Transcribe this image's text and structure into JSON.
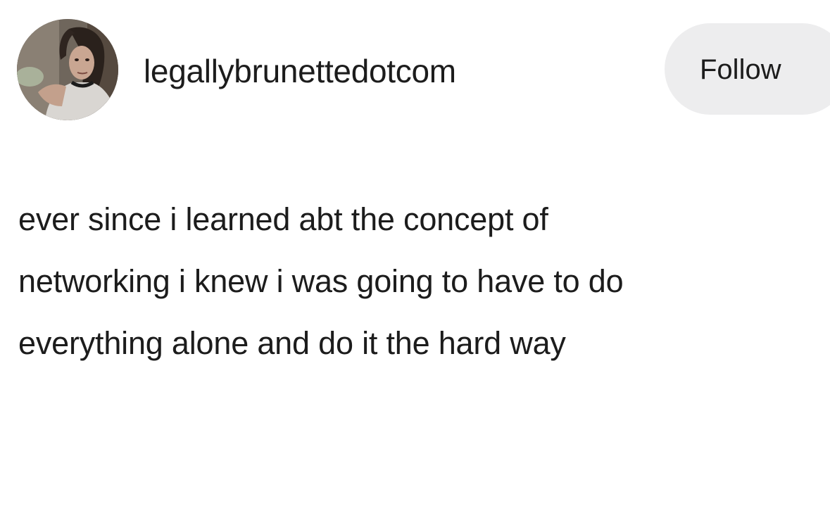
{
  "post": {
    "author": {
      "username": "legallybrunettedotcom",
      "avatar_icon": "profile-photo"
    },
    "follow_label": "Follow",
    "text_lines": [
      "ever since i learned abt the concept of",
      "networking i knew i was going to have to do",
      "everything alone and do it the hard way"
    ]
  },
  "colors": {
    "background": "#ffffff",
    "text": "#1c1c1c",
    "follow_button_bg": "#ededee"
  }
}
